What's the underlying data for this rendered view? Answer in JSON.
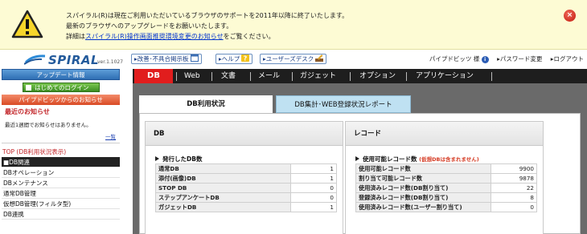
{
  "banner": {
    "line1": "スパイラル(R)は現在ご利用いただいているブラウザのサポートを2011年以降に終了いたします。",
    "line2": "最新のブラウザへのアップグレードをお願いいたします。",
    "line3_prefix": "詳細は",
    "line3_link": "スパイラル(R)操作画面推奨環境変更のお知らせ",
    "line3_suffix": "をご覧ください。"
  },
  "header": {
    "logo_text": "SPIRAL",
    "version": "ver.1.1027",
    "links": {
      "announcements": "▸改善･不具合掲示板",
      "help": "▸ヘルプ",
      "userdesk": "▸ユーザーズデスク"
    },
    "user": "パイプドビッツ 様",
    "password_change": "▸パスワード変更",
    "logout": "▸ログアウト"
  },
  "sidebar": {
    "update_info": "アップデート情報",
    "first_login": "はじめてのログイン",
    "notice_head": "パイプドビッツからのお知らせ",
    "recent_title": "最近のお知らせ",
    "recent_body": "最近1週間でお知らせはありません。",
    "list_link": "一覧",
    "top_link": "TOP (DB利用状況表示)",
    "items": [
      {
        "label": "■DB関連"
      },
      {
        "label": "DBオペレーション"
      },
      {
        "label": "DBメンテナンス"
      },
      {
        "label": "通常DB管理"
      },
      {
        "label": "仮想DB管理(フィルタ型)"
      },
      {
        "label": "DB連携"
      }
    ]
  },
  "nav": {
    "items": [
      "DB",
      "Web",
      "文書",
      "メール",
      "ガジェット",
      "オプション",
      "アプリケーション"
    ]
  },
  "tabs": {
    "active": "DB利用状況",
    "other": "DB集計･WEB登録状況レポート"
  },
  "db_box": {
    "head": "DB",
    "section": "発行したDB数",
    "rows": [
      {
        "label": "通常DB",
        "value": "1"
      },
      {
        "label": "添付(画像)DB",
        "value": "1"
      },
      {
        "label": "STOP DB",
        "value": "0"
      },
      {
        "label": "ステップアンケートDB",
        "value": "0"
      },
      {
        "label": "ガジェットDB",
        "value": "1"
      }
    ]
  },
  "record_box": {
    "head": "レコード",
    "section": "使用可能レコード数",
    "note": "(仮想DBは含まれません)",
    "rows": [
      {
        "label": "使用可能レコード数",
        "value": "9900"
      },
      {
        "label": "割り当て可能レコード数",
        "value": "9878"
      },
      {
        "label": "使用済みレコード数(DB割り当て)",
        "value": "22"
      },
      {
        "label": "登録済みレコード数(DB割り当て)",
        "value": "8"
      },
      {
        "label": "使用済みレコード数(ユーザー割り当て)",
        "value": "0"
      }
    ]
  },
  "colors": {
    "nav_active": "#e11d1d",
    "brand": "#235a9b",
    "notice_red": "#c3262a"
  }
}
